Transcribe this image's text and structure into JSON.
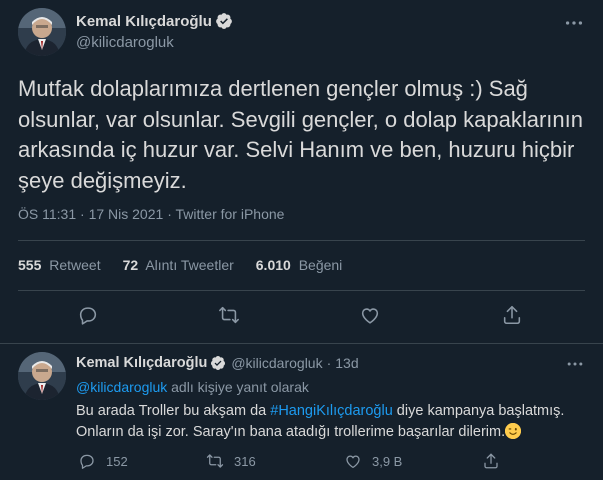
{
  "main_tweet": {
    "author": {
      "display_name": "Kemal Kılıçdaroğlu",
      "handle": "@kilicdarogluk",
      "verified": true
    },
    "text": "Mutfak dolaplarımıza dertlenen gençler olmuş :) Sağ olsunlar, var olsunlar. Sevgili gençler, o dolap kapaklarının arkasında iç huzur var. Selvi Hanım ve ben, huzuru hiçbir şeye değişmeyiz.",
    "time": "ÖS 11:31",
    "date": "17 Nis 2021",
    "separator": "·",
    "source": "Twitter for iPhone",
    "stats": {
      "retweets_count": "555",
      "retweets_label": "Retweet",
      "quotes_count": "72",
      "quotes_label": "Alıntı Tweetler",
      "likes_count": "6.010",
      "likes_label": "Beğeni"
    }
  },
  "reply_tweet": {
    "author": {
      "display_name": "Kemal Kılıçdaroğlu",
      "handle": "@kilicdarogluk",
      "time": "13d",
      "separator": "·"
    },
    "reply_to_handle": "@kilicdarogluk",
    "reply_to_suffix": "adlı kişiye yanıt olarak",
    "text_before": "Bu arada Troller bu akşam da ",
    "hashtag": "#HangiKılıçdaroğlu",
    "text_after": " diye kampanya başlatmış. Onların da işi zor. Saray'ın bana atadığı trollerime başarılar dilerim.",
    "emoji": "winking-face",
    "actions": {
      "replies": "152",
      "retweets": "316",
      "likes": "3,9 B"
    }
  },
  "colors": {
    "background": "#15202b",
    "text": "#d9d9d9",
    "secondary": "#8b98a5",
    "accent": "#1d9bf0",
    "divider": "#38444d"
  }
}
